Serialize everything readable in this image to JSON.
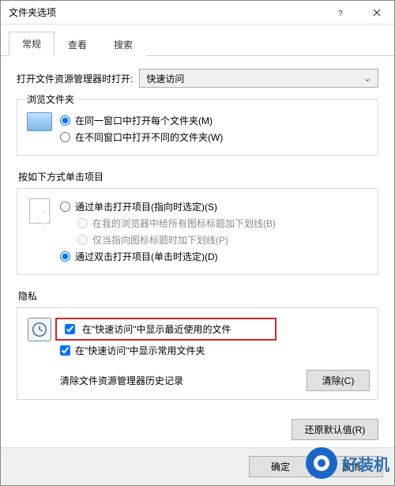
{
  "window": {
    "title": "文件夹选项"
  },
  "tabs": {
    "general": "常规",
    "view": "查看",
    "search": "搜索"
  },
  "open_explorer": {
    "label": "打开文件资源管理器时打开:",
    "selected": "快速访问"
  },
  "browse_group": {
    "legend": "浏览文件夹",
    "same_window": "在同一窗口中打开每个文件夹(M)",
    "new_window": "在不同窗口中打开不同的文件夹(W)"
  },
  "click_group": {
    "title": "按如下方式单击项目",
    "single_click": "通过单击打开项目(指向时选定)(S)",
    "underline_all": "在我的浏览器中给所有图标标题加下划线(B)",
    "underline_point": "仅当指向图标标题时加下划线(P)",
    "double_click": "通过双击打开项目(单击时选定)(D)"
  },
  "privacy_group": {
    "legend": "隐私",
    "recent_files": "在\"快速访问\"中显示最近使用的文件",
    "frequent_folders": "在\"快速访问\"中显示常用文件夹",
    "clear_label": "清除文件资源管理器历史记录",
    "clear_button": "清除(C)"
  },
  "restore_defaults": "还原默认值(R)",
  "buttons": {
    "ok": "确定",
    "cancel": "取消"
  },
  "watermark": "好装机"
}
